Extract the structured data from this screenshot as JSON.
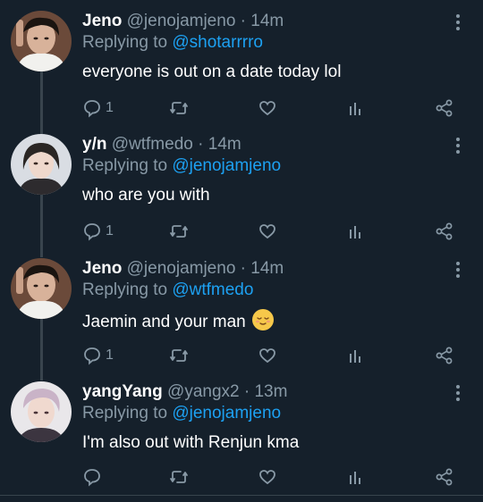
{
  "tweets": [
    {
      "name": "Jeno",
      "handle": "@jenojamjeno",
      "time": "14m",
      "replying_prefix": "Replying to",
      "replying_to": "@shotarrrro",
      "text": "everyone is out on a date today lol",
      "reply_count": "1",
      "avatar": "avatar-jeno"
    },
    {
      "name": "y/n",
      "handle": "@wtfmedo",
      "time": "14m",
      "replying_prefix": "Replying to",
      "replying_to": "@jenojamjeno",
      "text": "who are you with",
      "reply_count": "1",
      "avatar": "avatar-yn"
    },
    {
      "name": "Jeno",
      "handle": "@jenojamjeno",
      "time": "14m",
      "replying_prefix": "Replying to",
      "replying_to": "@wtfmedo",
      "text": "Jaemin and your man",
      "text_emoji": "relieved-face-emoji",
      "reply_count": "1",
      "avatar": "avatar-jeno"
    },
    {
      "name": "yangYang",
      "handle": "@yangx2",
      "time": "13m",
      "replying_prefix": "Replying to",
      "replying_to": "@jenojamjeno",
      "text": "I'm also out with Renjun kma",
      "reply_count": "",
      "avatar": "avatar-yangyang"
    }
  ],
  "separator": "·",
  "icons": [
    "reply-icon",
    "retweet-icon",
    "like-icon",
    "analytics-icon",
    "share-icon",
    "more-icon"
  ],
  "colors": {
    "background": "#15202b",
    "text_primary": "#ffffff",
    "text_secondary": "#8899a6",
    "mention": "#1da1f2",
    "thread_line": "#38444d"
  }
}
